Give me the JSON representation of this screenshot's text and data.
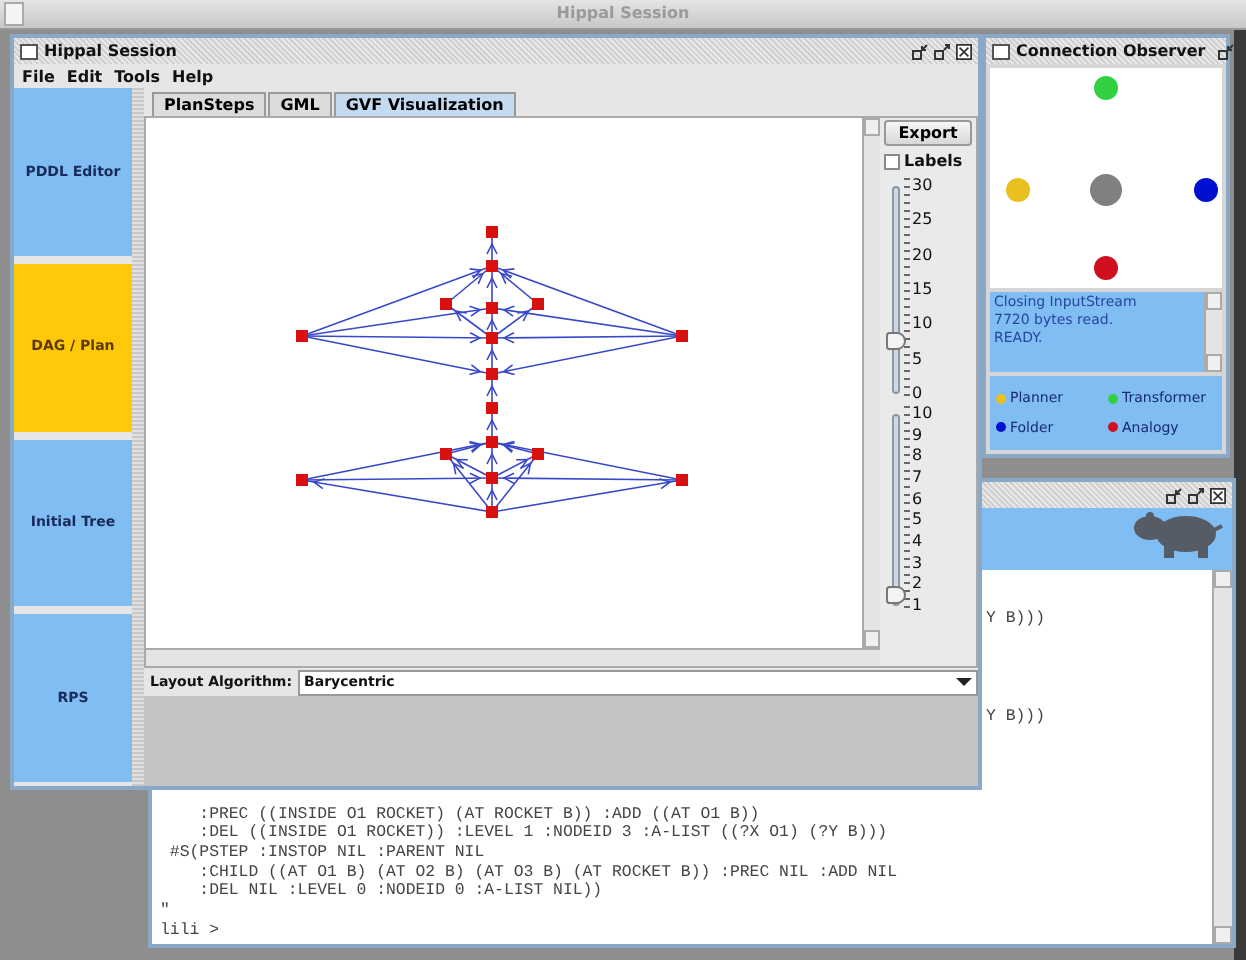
{
  "app_title": "Hippal Session",
  "main_window": {
    "title": "Hippal Session",
    "menu": [
      "File",
      "Edit",
      "Tools",
      "Help"
    ],
    "sidebar": [
      {
        "label": "PDDL Editor",
        "selected": false
      },
      {
        "label": "DAG / Plan",
        "selected": true
      },
      {
        "label": "Initial Tree",
        "selected": false
      },
      {
        "label": "RPS",
        "selected": false
      }
    ],
    "tabs": [
      {
        "label": "PlanSteps",
        "selected": false
      },
      {
        "label": "GML",
        "selected": false
      },
      {
        "label": "GVF Visualization",
        "selected": true
      }
    ],
    "export_button": "Export",
    "labels_checkbox": {
      "label": "Labels",
      "checked": false
    },
    "slider_1": {
      "ticks": [
        "30",
        "25",
        "20",
        "15",
        "10",
        "5",
        "0"
      ],
      "level": 0.23
    },
    "slider_2": {
      "ticks": [
        "10",
        "9",
        "8",
        "7",
        "6",
        "5",
        "4",
        "3",
        "2",
        "1"
      ],
      "level": 0
    },
    "layout_algorithm": {
      "label": "Layout Algorithm:",
      "value": "Barycentric"
    }
  },
  "connection_observer": {
    "title": "Connection Observer",
    "log": [
      "Closing InputStream",
      "7720 bytes read.",
      "READY."
    ],
    "legend": [
      {
        "label": "Planner",
        "color": "#e8c020"
      },
      {
        "label": "Transformer",
        "color": "#30d040"
      },
      {
        "label": "Folder",
        "color": "#0010d0"
      },
      {
        "label": "Analogy",
        "color": "#d01020"
      }
    ]
  },
  "console": {
    "partial_lines": [
      "Y B)))",
      "Y B)))"
    ],
    "lines": [
      "    :PREC ((INSIDE O1 ROCKET) (AT ROCKET B)) :ADD ((AT O1 B))",
      "    :DEL ((INSIDE O1 ROCKET)) :LEVEL 1 :NODEID 3 :A-LIST ((?X O1) (?Y B)))",
      " #S(PSTEP :INSTOP NIL :PARENT NIL",
      "    :CHILD ((AT O1 B) (AT O2 B) (AT O3 B) (AT ROCKET B)) :PREC NIL :ADD NIL",
      "    :DEL NIL :LEVEL 0 :NODEID 0 :A-LIST NIL))",
      "\""
    ],
    "prompt": "lili >"
  }
}
